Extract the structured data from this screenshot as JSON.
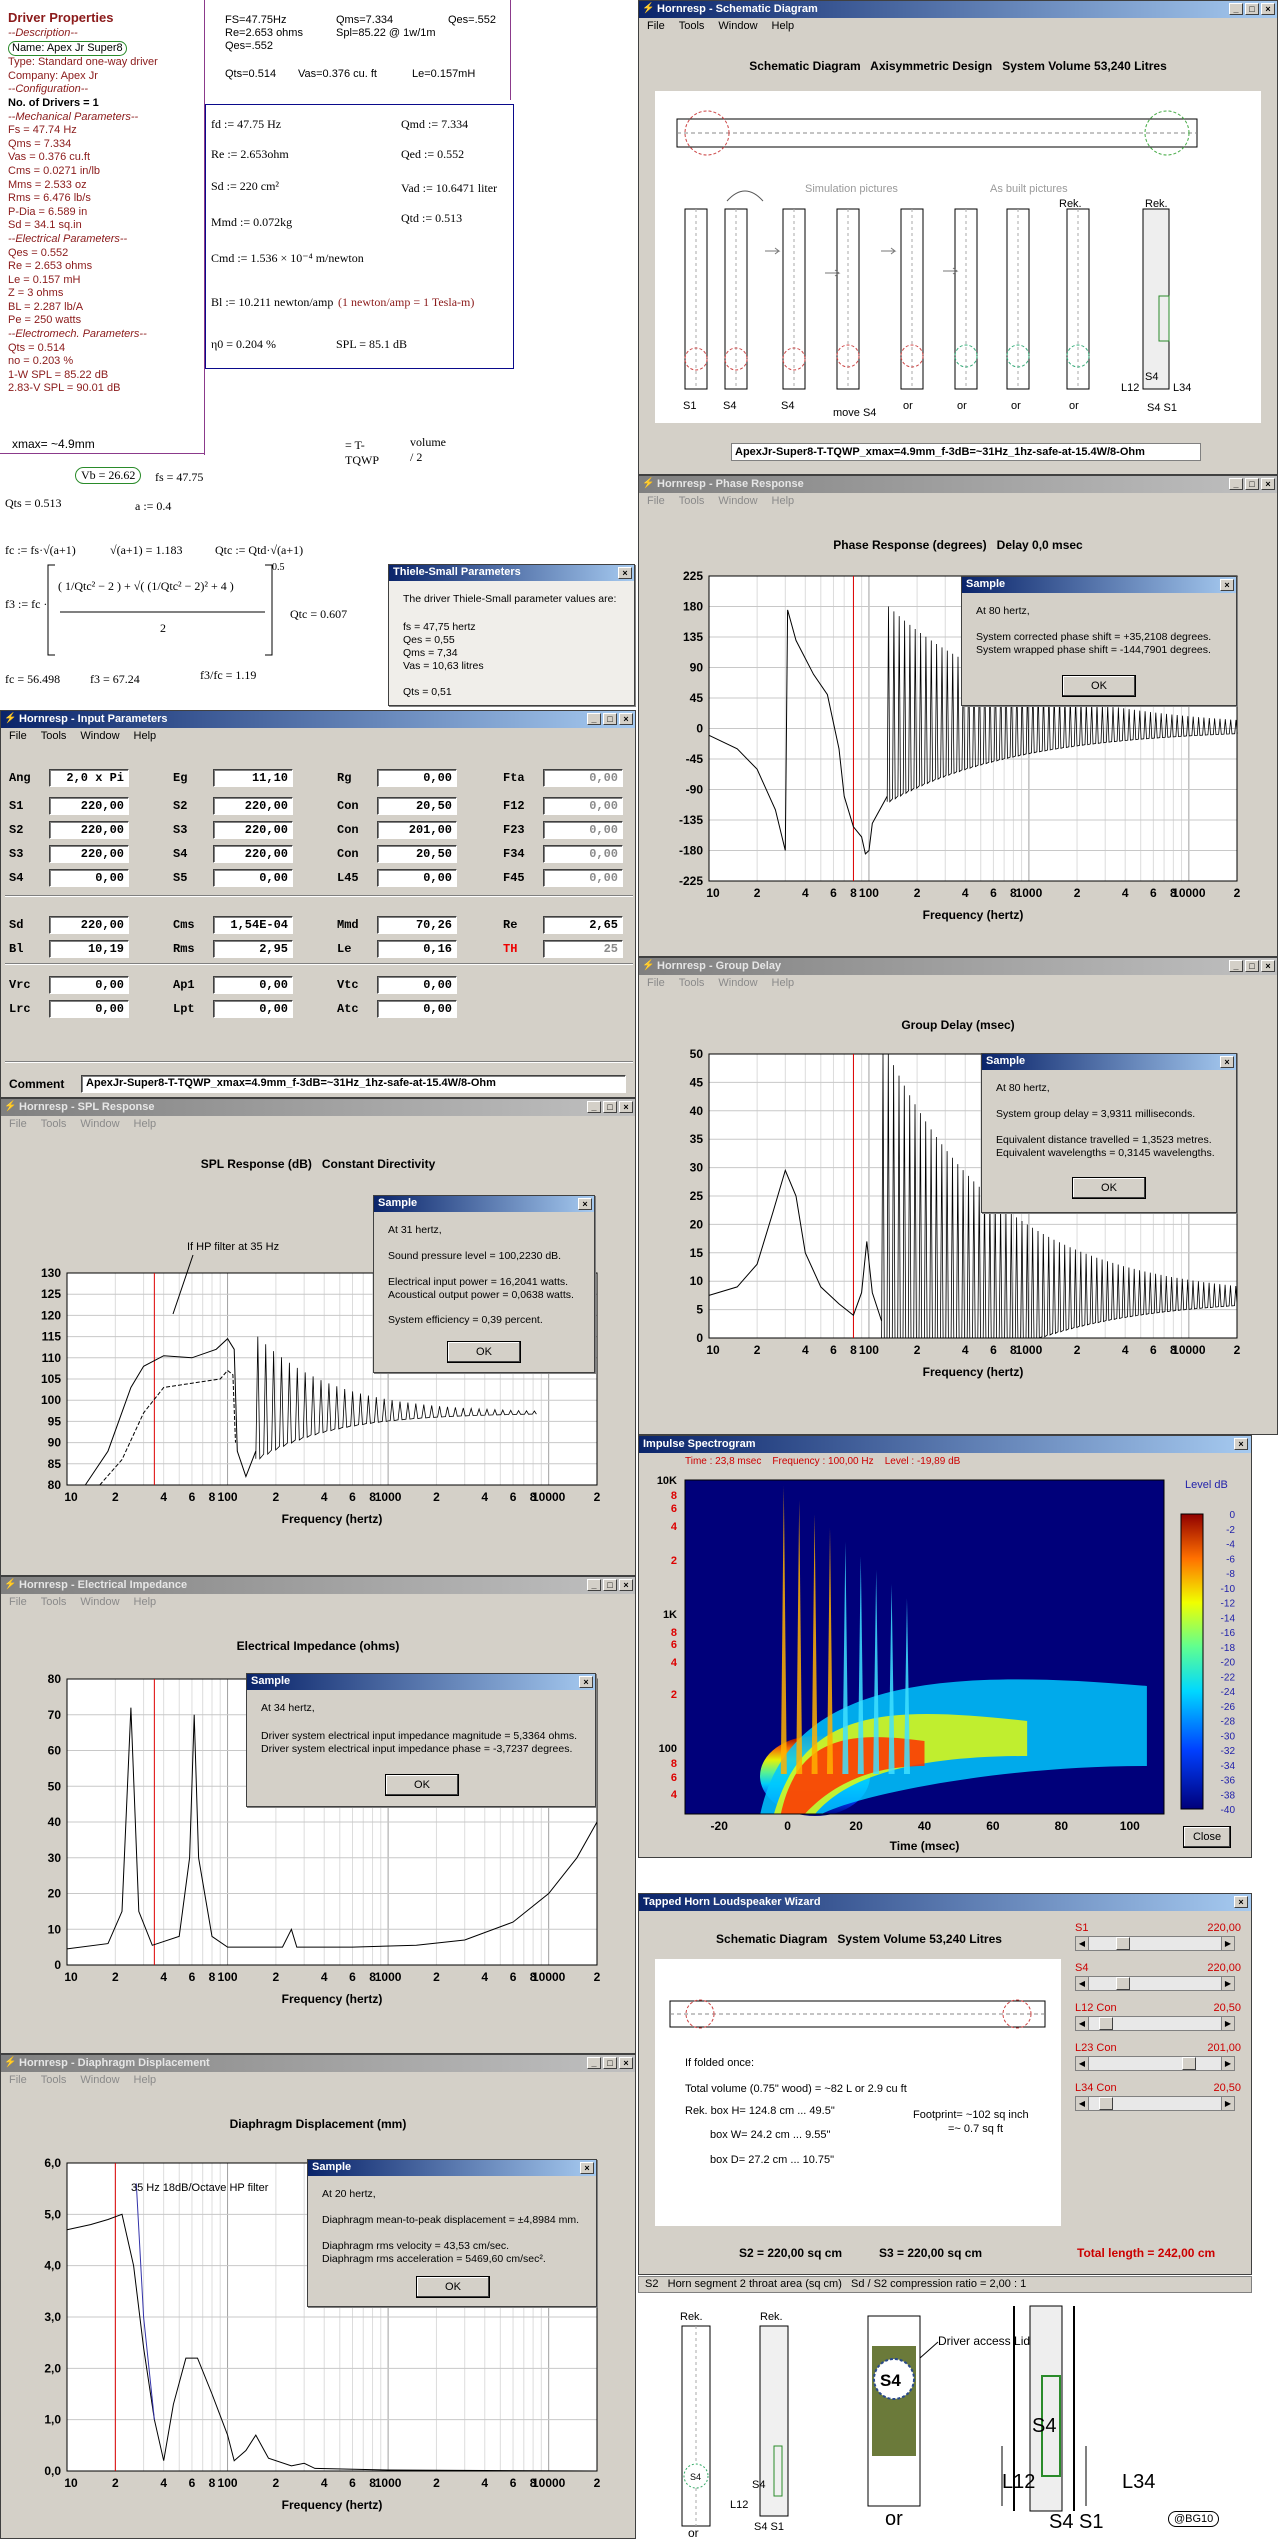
{
  "driver": {
    "title": "Driver Properties",
    "lines": [
      "--Description--",
      "Name: Apex Jr Super8",
      "Type: Standard one-way driver",
      "Company: Apex Jr",
      "--Configuration--",
      "No. of Drivers = 1",
      "--Mechanical Parameters--",
      "Fs = 47.74 Hz",
      "Qms = 7.334",
      "Vas = 0.376 cu.ft",
      "Cms = 0.0271 in/lb",
      "Mms = 2.533 oz",
      "Rms = 6.476 lb/s",
      "P-Dia = 6.589 in",
      "Sd = 34.1 sq.in",
      "--Electrical Parameters--",
      "Qes = 0.552",
      "Re = 2.653 ohms",
      "Le = 0.157 mH",
      "Z = 3 ohms",
      "BL = 2.287 lb/A",
      "Pe = 250 watts",
      "--Electromech. Parameters--",
      "Qts = 0.514",
      "no = 0.203 %",
      "1-W SPL = 85.22 dB",
      "2.83-V SPL = 90.01 dB"
    ],
    "xmax": "xmax= ~4.9mm"
  },
  "math": {
    "top1": "FS=47.75Hz",
    "top2": "Re=2.653 ohms",
    "top3": "Qes=.552",
    "top4": "Qms=7.334",
    "top5": "Spl=85.22 @ 1w/1m",
    "top6": "Qes=.552",
    "top7": "Qts=0.514",
    "top8": "Vas=0.376 cu. ft",
    "top9": "Le=0.157mH",
    "box": [
      "fd := 47.75 Hz",
      "Qmd := 7.334",
      "Re := 2.653ohm",
      "Qed := 0.552",
      "Sd := 220 cm²",
      "Vad := 10.6471 liter",
      "Qtd := 0.513",
      "Mmd := 0.072kg",
      "Cmd := 1.536 × 10⁻⁴ m/newton",
      "Bl := 10.211 newton/amp",
      "(1 newton/amp = 1 Tesla-m)",
      "η0 = 0.204 %",
      "SPL = 85.1  dB"
    ],
    "l1": "Vb = 26.62",
    "l2": "fs = 47.75",
    "l3": "= T-TQWP",
    "l4": "volume / 2",
    "l5": "Qts = 0.513",
    "l6": "a := 0.4",
    "l7": "fc := fs·√(a+1)",
    "l8": "√(a+1) = 1.183",
    "l9": "Qtc := Qtd·√(a+1)",
    "l10": "Qtc = 0.607",
    "l11": "fc = 56.498",
    "l12": "f3 = 67.24",
    "l13": "f3/fc = 1.19"
  },
  "thiele": {
    "title": "Thiele-Small Parameters",
    "intro": "The driver Thiele-Small parameter values are:",
    "lines": [
      "fs = 47,75 hertz",
      "Qes = 0,55",
      "Qms = 7,34",
      "Vas = 10,63 litres",
      "",
      "Qts = 0,51"
    ]
  },
  "schematic": {
    "title": "Hornresp - Schematic Diagram",
    "menus": [
      "File",
      "Tools",
      "Window",
      "Help"
    ],
    "heading": "Schematic Diagram   Axisymmetric Design   System Volume 53,240 Litres",
    "sim": "Simulation pictures",
    "built": "As built pictures",
    "labels": [
      "S1",
      "S4",
      "S4",
      "move S4",
      "or",
      "or",
      "or",
      "or",
      "Rek.",
      "Rek.",
      "S4",
      "L12",
      "L34",
      "S4 S1"
    ],
    "comment": "ApexJr-Super8-T-TQWP_xmax=4.9mm_f-3dB=~31Hz_1hz-safe-at-15.4W/8-Ohm"
  },
  "phase": {
    "title": "Hornresp - Phase Response",
    "menus": [
      "File",
      "Tools",
      "Window",
      "Help"
    ],
    "heading": "Phase Response (degrees)   Delay 0,0 msec",
    "yticks": [
      "225",
      "180",
      "135",
      "90",
      "45",
      "0",
      "-45",
      "-90",
      "-135",
      "-180",
      "-225"
    ],
    "xticks": [
      "10",
      "2",
      "4",
      "6",
      "8",
      "100",
      "2",
      "4",
      "6",
      "8",
      "1000",
      "2",
      "4",
      "6",
      "8",
      "10000",
      "2"
    ],
    "xlabel": "Frequency (hertz)",
    "dialog": {
      "title": "Sample",
      "l1": "At 80 hertz,",
      "l2": "System corrected phase shift = +35,2108 degrees.",
      "l3": "System wrapped phase shift = -144,7901 degrees.",
      "ok": "OK"
    }
  },
  "group": {
    "title": "Hornresp - Group Delay",
    "menus": [
      "File",
      "Tools",
      "Window",
      "Help"
    ],
    "heading": "Group Delay (msec)",
    "yticks": [
      "50",
      "45",
      "40",
      "35",
      "30",
      "25",
      "20",
      "15",
      "10",
      "5",
      "0"
    ],
    "xticks": [
      "10",
      "2",
      "4",
      "6",
      "8",
      "100",
      "2",
      "4",
      "6",
      "8",
      "1000",
      "2",
      "4",
      "6",
      "8",
      "10000",
      "2"
    ],
    "xlabel": "Frequency (hertz)",
    "dialog": {
      "title": "Sample",
      "l1": "At 80 hertz,",
      "l2": "System group delay = 3,9311 milliseconds.",
      "l3": "Equivalent distance travelled = 1,3523 metres.",
      "l4": "Equivalent wavelengths = 0,3145 wavelengths.",
      "ok": "OK"
    }
  },
  "input": {
    "title": "Hornresp - Input Parameters",
    "menus": [
      "File",
      "Tools",
      "Window",
      "Help"
    ],
    "rows": [
      [
        [
          "Ang",
          "2,0 x Pi"
        ],
        [
          "Eg",
          "11,10"
        ],
        [
          "Rg",
          "0,00"
        ],
        [
          "Fta",
          "0,00"
        ]
      ],
      [
        [
          "S1",
          "220,00"
        ],
        [
          "S2",
          "220,00"
        ],
        [
          "Con",
          "20,50"
        ],
        [
          "F12",
          "0,00"
        ]
      ],
      [
        [
          "S2",
          "220,00"
        ],
        [
          "S3",
          "220,00"
        ],
        [
          "Con",
          "201,00"
        ],
        [
          "F23",
          "0,00"
        ]
      ],
      [
        [
          "S3",
          "220,00"
        ],
        [
          "S4",
          "220,00"
        ],
        [
          "Con",
          "20,50"
        ],
        [
          "F34",
          "0,00"
        ]
      ],
      [
        [
          "S4",
          "0,00"
        ],
        [
          "S5",
          "0,00"
        ],
        [
          "L45",
          "0,00"
        ],
        [
          "F45",
          "0,00"
        ]
      ],
      [
        [
          "Sd",
          "220,00"
        ],
        [
          "Cms",
          "1,54E-04"
        ],
        [
          "Mmd",
          "70,26"
        ],
        [
          "Re",
          "2,65"
        ]
      ],
      [
        [
          "Bl",
          "10,19"
        ],
        [
          "Rms",
          "2,95"
        ],
        [
          "Le",
          "0,16"
        ],
        [
          "TH",
          "25"
        ]
      ],
      [
        [
          "Vrc",
          "0,00"
        ],
        [
          "Ap1",
          "0,00"
        ],
        [
          "Vtc",
          "0,00"
        ]
      ],
      [
        [
          "Lrc",
          "0,00"
        ],
        [
          "Lpt",
          "0,00"
        ],
        [
          "Atc",
          "0,00"
        ]
      ]
    ],
    "comment_label": "Comment",
    "comment": "ApexJr-Super8-T-TQWP_xmax=4.9mm_f-3dB=~31Hz_1hz-safe-at-15.4W/8-Ohm"
  },
  "spl": {
    "title": "Hornresp - SPL Response",
    "menus": [
      "File",
      "Tools",
      "Window",
      "Help"
    ],
    "heading": "SPL Response (dB)   Constant Directivity",
    "yticks": [
      "130",
      "125",
      "120",
      "115",
      "110",
      "105",
      "100",
      "95",
      "90",
      "85",
      "80"
    ],
    "xticks": [
      "10",
      "2",
      "4",
      "6",
      "8",
      "100",
      "2",
      "4",
      "6",
      "8",
      "1000",
      "2",
      "4",
      "6",
      "8",
      "10000",
      "2"
    ],
    "xlabel": "Frequency (hertz)",
    "annot": "If HP filter at 35 Hz",
    "dialog": {
      "title": "Sample",
      "l1": "At 31 hertz,",
      "l2": "Sound pressure level = 100,2230 dB.",
      "l3": "Electrical input power = 16,2041 watts.",
      "l4": "Acoustical output power = 0,0638 watts.",
      "l5": "System efficiency = 0,39 percent.",
      "ok": "OK"
    }
  },
  "imp": {
    "title": "Hornresp - Electrical Impedance",
    "menus": [
      "File",
      "Tools",
      "Window",
      "Help"
    ],
    "heading": "Electrical Impedance (ohms)",
    "yticks": [
      "80",
      "70",
      "60",
      "50",
      "40",
      "30",
      "20",
      "10",
      "0"
    ],
    "xticks": [
      "10",
      "2",
      "4",
      "6",
      "8",
      "100",
      "2",
      "4",
      "6",
      "8",
      "1000",
      "2",
      "4",
      "6",
      "8",
      "10000",
      "2"
    ],
    "xlabel": "Frequency (hertz)",
    "dialog": {
      "title": "Sample",
      "l1": "At 34 hertz,",
      "l2": "Driver system electrical input impedance magnitude = 5,3364 ohms.",
      "l3": "Driver system electrical input impedance phase = -3,7237 degrees.",
      "ok": "OK"
    }
  },
  "disp": {
    "title": "Hornresp - Diaphragm Displacement",
    "menus": [
      "File",
      "Tools",
      "Window",
      "Help"
    ],
    "heading": "Diaphragm Displacement (mm)",
    "yticks": [
      "6,0",
      "5,0",
      "4,0",
      "3,0",
      "2,0",
      "1,0",
      "0,0"
    ],
    "xticks": [
      "10",
      "2",
      "4",
      "6",
      "8",
      "100",
      "2",
      "4",
      "6",
      "8",
      "1000",
      "2",
      "4",
      "6",
      "8",
      "10000",
      "2"
    ],
    "xlabel": "Frequency (hertz)",
    "annot": "35 Hz 18dB/Octave HP filter",
    "dialog": {
      "title": "Sample",
      "l1": "At 20 hertz,",
      "l2": "Diaphragm mean-to-peak displacement = ±4,8984 mm.",
      "l3": "Diaphragm rms velocity = 43,53 cm/sec.",
      "l4": "Diaphragm rms acceleration = 5469,60 cm/sec².",
      "ok": "OK"
    }
  },
  "spectro": {
    "title": "Impulse Spectrogram",
    "info": "Time : 23,8 msec    Frequency : 100,00 Hz    Level : -19,89 dB",
    "level": "Level   dB",
    "levels": [
      "0",
      "-2",
      "-4",
      "-6",
      "-8",
      "-10",
      "-12",
      "-14",
      "-16",
      "-18",
      "-20",
      "-22",
      "-24",
      "-26",
      "-28",
      "-30",
      "-32",
      "-34",
      "-36",
      "-38",
      "-40"
    ],
    "yticks": [
      "10K",
      "8",
      "6",
      "4",
      "2",
      "1K",
      "8",
      "6",
      "4",
      "2",
      "100",
      "8",
      "6",
      "4"
    ],
    "xticks": [
      "-20",
      "0",
      "20",
      "40",
      "60",
      "80",
      "100"
    ],
    "xlabel": "Time (msec)",
    "close": "Close"
  },
  "wizard": {
    "title": "Tapped Horn Loudspeaker Wizard",
    "heading": "Schematic Diagram   System Volume 53,240 Litres",
    "lines": [
      "If folded once:",
      "Total volume (0.75\" wood) = ~82 L  or  2.9 cu ft",
      "Rek. box H= 124.8 cm  ...  49.5\"",
      "box W= 24.2 cm  ...  9.55\"",
      "box  D= 27.2 cm  ...  10.75\"",
      "Footprint= ~102 sq inch",
      "=~ 0.7 sq ft"
    ],
    "sliders": [
      {
        "name": "S1",
        "value": "220,00",
        "pos": 0.22
      },
      {
        "name": "S4",
        "value": "220,00",
        "pos": 0.22
      },
      {
        "name": "L12 Con",
        "value": "20,50",
        "pos": 0.08
      },
      {
        "name": "L23 Con",
        "value": "201,00",
        "pos": 0.78
      },
      {
        "name": "L34 Con",
        "value": "20,50",
        "pos": 0.08
      }
    ],
    "s2": "S2 = 220,00 sq cm",
    "s3": "S3 = 220,00 sq cm",
    "total": "Total length = 242,00 cm",
    "status": "S2   Horn segment 2 throat area (sq cm)   Sd / S2 compression ratio = 2,00 : 1"
  },
  "bottom": {
    "rek1": "Rek.",
    "rek2": "Rek.",
    "s4a": "S4",
    "l12a": "L12",
    "s4s1a": "S4 S1",
    "or1": "or",
    "or2": "or",
    "s4b": "S4",
    "access": "Driver access Lid",
    "s4c": "S4",
    "l12": "L12",
    "l34": "L34",
    "s4s1": "S4 S1",
    "sig": "@BG10"
  },
  "chart_data": [
    {
      "type": "line",
      "title": "Phase Response (degrees)   Delay 0,0 msec",
      "xlabel": "Frequency (hertz)",
      "x_scale": "log",
      "xlim": [
        10,
        20000
      ],
      "ylim": [
        -225,
        225
      ],
      "series": [
        {
          "values": [
            [
              10,
              -10
            ],
            [
              20,
              -60
            ],
            [
              30,
              -180
            ],
            [
              31,
              175
            ],
            [
              50,
              60
            ],
            [
              60,
              -80
            ],
            [
              80,
              -145
            ],
            [
              100,
              -160
            ],
            [
              200,
              150
            ],
            [
              1000,
              10
            ],
            [
              20000,
              0
            ]
          ]
        }
      ]
    },
    {
      "type": "line",
      "title": "Group Delay (msec)",
      "xlabel": "Frequency (hertz)",
      "x_scale": "log",
      "xlim": [
        10,
        20000
      ],
      "ylim": [
        0,
        50
      ],
      "series": [
        {
          "values": [
            [
              10,
              8
            ],
            [
              20,
              18
            ],
            [
              30,
              30
            ],
            [
              50,
              10
            ],
            [
              80,
              4
            ],
            [
              95,
              16
            ],
            [
              150,
              3
            ],
            [
              200,
              45
            ],
            [
              400,
              25
            ],
            [
              1000,
              10
            ],
            [
              3000,
              8
            ],
            [
              20000,
              7
            ]
          ]
        }
      ]
    },
    {
      "type": "line",
      "title": "SPL Response (dB)   Constant Directivity",
      "xlabel": "Frequency (hertz)",
      "x_scale": "log",
      "xlim": [
        10,
        20000
      ],
      "ylim": [
        80,
        130
      ],
      "series": [
        {
          "values": [
            [
              20,
              85
            ],
            [
              30,
              108
            ],
            [
              31,
              100.2
            ],
            [
              60,
              110
            ],
            [
              100,
              115
            ],
            [
              110,
              88
            ],
            [
              200,
              112
            ],
            [
              500,
              100
            ],
            [
              1000,
              95
            ],
            [
              5000,
              85
            ],
            [
              8000,
              80
            ]
          ]
        }
      ]
    },
    {
      "type": "line",
      "title": "Electrical Impedance (ohms)",
      "xlabel": "Frequency (hertz)",
      "x_scale": "log",
      "xlim": [
        10,
        20000
      ],
      "ylim": [
        0,
        80
      ],
      "series": [
        {
          "values": [
            [
              10,
              5
            ],
            [
              25,
              72
            ],
            [
              34,
              5.34
            ],
            [
              60,
              70
            ],
            [
              80,
              5
            ],
            [
              350,
              5
            ],
            [
              1000,
              5
            ],
            [
              5000,
              12
            ],
            [
              20000,
              40
            ]
          ]
        }
      ]
    },
    {
      "type": "line",
      "title": "Diaphragm Displacement (mm)",
      "xlabel": "Frequency (hertz)",
      "x_scale": "log",
      "xlim": [
        10,
        20000
      ],
      "ylim": [
        0,
        6
      ],
      "series": [
        {
          "values": [
            [
              10,
              4.8
            ],
            [
              20,
              4.9
            ],
            [
              30,
              2.5
            ],
            [
              40,
              0.2
            ],
            [
              60,
              2.3
            ],
            [
              100,
              1.0
            ],
            [
              150,
              0.3
            ],
            [
              300,
              0.15
            ],
            [
              1000,
              0.02
            ],
            [
              20000,
              0
            ]
          ]
        }
      ]
    }
  ]
}
